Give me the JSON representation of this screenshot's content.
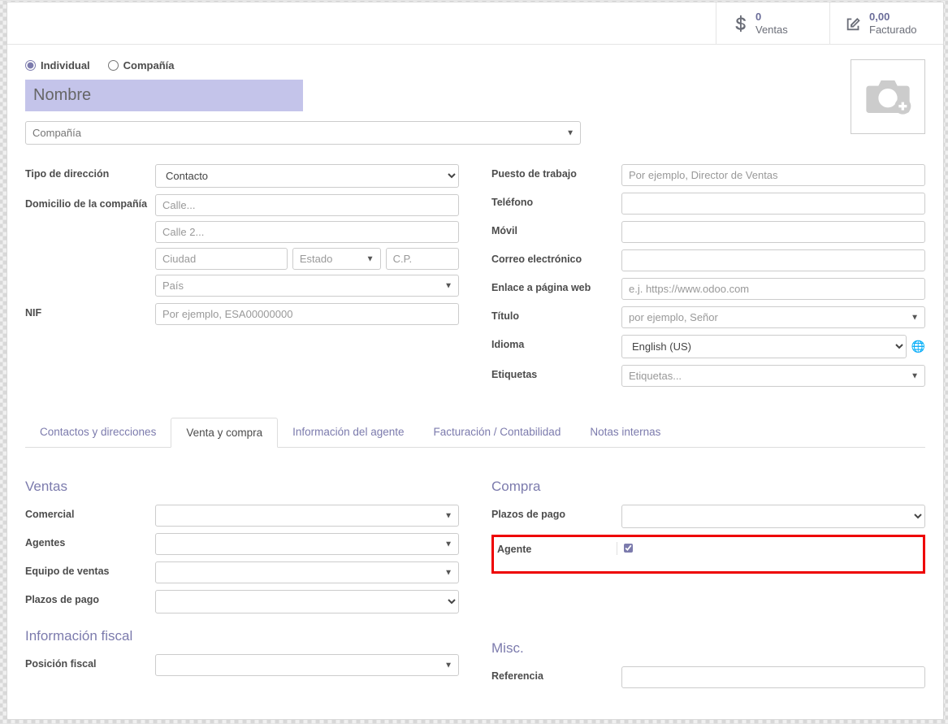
{
  "stats": {
    "sales_value": "0",
    "sales_label": "Ventas",
    "invoiced_value": "0,00",
    "invoiced_label": "Facturado"
  },
  "contact_type": {
    "individual": "Individual",
    "company": "Compañía"
  },
  "name_placeholder": "Nombre",
  "company_placeholder": "Compañía",
  "left_fields": {
    "address_type_label": "Tipo de dirección",
    "address_type_value": "Contacto",
    "company_address_label": "Domicilio de la compañía",
    "street_placeholder": "Calle...",
    "street2_placeholder": "Calle 2...",
    "city_placeholder": "Ciudad",
    "state_placeholder": "Estado",
    "zip_placeholder": "C.P.",
    "country_placeholder": "País",
    "nif_label": "NIF",
    "nif_placeholder": "Por ejemplo, ESA00000000"
  },
  "right_fields": {
    "job_label": "Puesto de trabajo",
    "job_placeholder": "Por ejemplo, Director de Ventas",
    "phone_label": "Teléfono",
    "mobile_label": "Móvil",
    "email_label": "Correo electrónico",
    "website_label": "Enlace a página web",
    "website_placeholder": "e.j. https://www.odoo.com",
    "title_label": "Título",
    "title_placeholder": "por ejemplo, Señor",
    "language_label": "Idioma",
    "language_value": "English (US)",
    "tags_label": "Etiquetas",
    "tags_placeholder": "Etiquetas..."
  },
  "tabs": {
    "contacts": "Contactos y direcciones",
    "sale_purchase": "Venta y compra",
    "agent_info": "Información del agente",
    "accounting": "Facturación / Contabilidad",
    "notes": "Notas internas"
  },
  "sections": {
    "sales_heading": "Ventas",
    "purchase_heading": "Compra",
    "fiscal_heading": "Información fiscal",
    "misc_heading": "Misc.",
    "salesperson_label": "Comercial",
    "agents_label": "Agentes",
    "sales_team_label": "Equipo de ventas",
    "payment_terms_label": "Plazos de pago",
    "purchase_payment_terms_label": "Plazos de pago",
    "agent_label": "Agente",
    "fiscal_position_label": "Posición fiscal",
    "reference_label": "Referencia"
  }
}
